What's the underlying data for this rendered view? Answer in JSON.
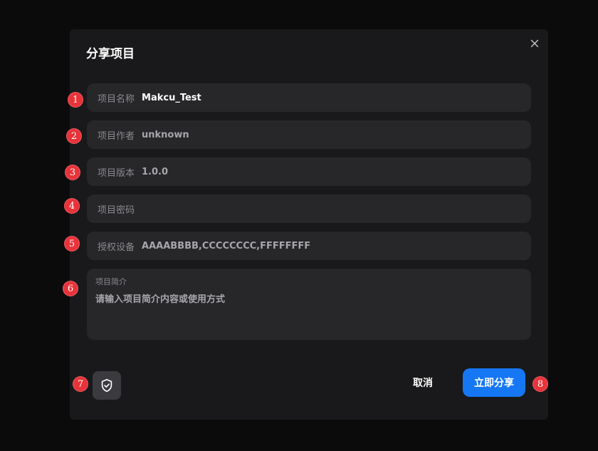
{
  "dialog": {
    "title": "分享项目",
    "close_icon": "close-icon"
  },
  "fields": [
    {
      "label": "项目名称",
      "value": "Makcu_Test"
    },
    {
      "label": "项目作者",
      "value": "unknown"
    },
    {
      "label": "项目版本",
      "value": "1.0.0"
    },
    {
      "label": "项目密码",
      "value": ""
    },
    {
      "label": "授权设备",
      "value": "AAAABBBB,CCCCCCCC,FFFFFFFF"
    }
  ],
  "description": {
    "label": "项目简介",
    "placeholder": "请输入项目简介内容或使用方式"
  },
  "footer": {
    "shield_icon": "shield-check-icon",
    "cancel_label": "取消",
    "share_label": "立即分享"
  },
  "markers": [
    "1",
    "2",
    "3",
    "4",
    "5",
    "6",
    "7",
    "8"
  ],
  "colors": {
    "background": "#0b0b0c",
    "dialog": "#19191b",
    "field": "#27272a",
    "primary": "#1677f5",
    "marker": "#e8333a"
  }
}
